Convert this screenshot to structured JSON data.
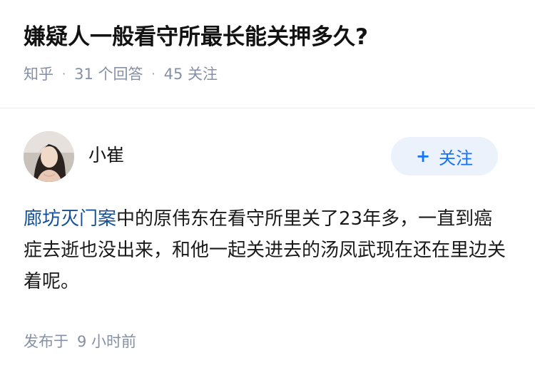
{
  "question": {
    "title": "嫌疑人一般看守所最长能关押多久?",
    "source": "知乎",
    "separator": "·",
    "answer_count": "31",
    "answer_label": "个回答",
    "follower_count": "45",
    "follower_label": "关注"
  },
  "answer": {
    "author_name": "小崔",
    "follow_button": {
      "icon": "+",
      "label": "关注"
    },
    "body": {
      "link_text": "廊坊灭门案",
      "text": "中的原伟东在看守所里关了23年多，一直到癌症去逝也没出来，和他一起关进去的汤凤武现在还在里边关着呢。"
    },
    "posted_label": "发布于",
    "posted_time": "9 小时前"
  },
  "colors": {
    "link": "#175199",
    "accent": "#1772f6",
    "muted": "#8590a6",
    "follow_bg": "#ebf2fb"
  }
}
